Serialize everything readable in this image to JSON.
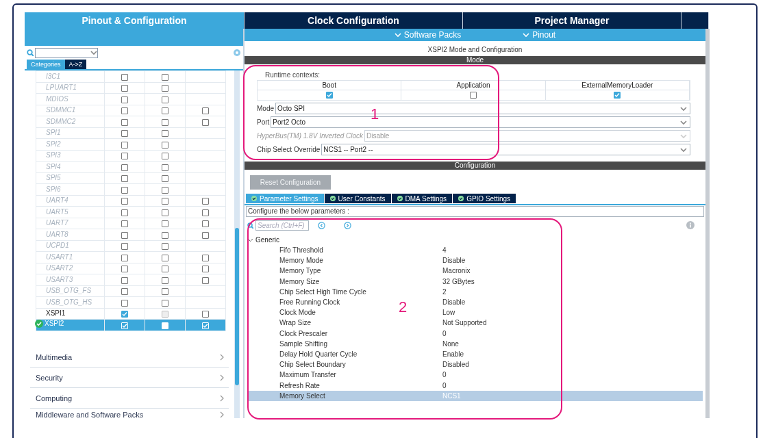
{
  "top_tabs": [
    {
      "label": "Pinout & Configuration",
      "selected": true
    },
    {
      "label": "Clock Configuration",
      "selected": false
    },
    {
      "label": "Project Manager",
      "selected": false
    },
    {
      "selected": false
    }
  ],
  "sub_menus": [
    {
      "label": "Software Packs"
    },
    {
      "label": "Pinout"
    }
  ],
  "left_panel": {
    "view_tabs": [
      {
        "label": "Categories",
        "selected": true
      },
      {
        "label": "A->Z",
        "selected": false
      }
    ],
    "peripherals": [
      {
        "name": "I3C1",
        "disabled": true,
        "selected": false,
        "configured": false,
        "checks": [
          {
            "checked": false,
            "disabled": false
          },
          {
            "checked": false,
            "disabled": false
          }
        ]
      },
      {
        "name": "LPUART1",
        "disabled": true,
        "selected": false,
        "configured": false,
        "checks": [
          {
            "checked": false,
            "disabled": false
          },
          {
            "checked": false,
            "disabled": false
          }
        ]
      },
      {
        "name": "MDIOS",
        "disabled": true,
        "selected": false,
        "configured": false,
        "checks": [
          {
            "checked": false,
            "disabled": false
          },
          {
            "checked": false,
            "disabled": false
          }
        ]
      },
      {
        "name": "SDMMC1",
        "disabled": true,
        "selected": false,
        "configured": false,
        "checks": [
          {
            "checked": false,
            "disabled": false
          },
          {
            "checked": false,
            "disabled": false
          },
          {
            "checked": false,
            "disabled": false
          }
        ]
      },
      {
        "name": "SDMMC2",
        "disabled": true,
        "selected": false,
        "configured": false,
        "checks": [
          {
            "checked": false,
            "disabled": false
          },
          {
            "checked": false,
            "disabled": false
          },
          {
            "checked": false,
            "disabled": false
          }
        ]
      },
      {
        "name": "SPI1",
        "disabled": true,
        "selected": false,
        "configured": false,
        "checks": [
          {
            "checked": false,
            "disabled": false
          },
          {
            "checked": false,
            "disabled": false
          }
        ]
      },
      {
        "name": "SPI2",
        "disabled": true,
        "selected": false,
        "configured": false,
        "checks": [
          {
            "checked": false,
            "disabled": false
          },
          {
            "checked": false,
            "disabled": false
          }
        ]
      },
      {
        "name": "SPI3",
        "disabled": true,
        "selected": false,
        "configured": false,
        "checks": [
          {
            "checked": false,
            "disabled": false
          },
          {
            "checked": false,
            "disabled": false
          }
        ]
      },
      {
        "name": "SPI4",
        "disabled": true,
        "selected": false,
        "configured": false,
        "checks": [
          {
            "checked": false,
            "disabled": false
          },
          {
            "checked": false,
            "disabled": false
          }
        ]
      },
      {
        "name": "SPI5",
        "disabled": true,
        "selected": false,
        "configured": false,
        "checks": [
          {
            "checked": false,
            "disabled": false
          },
          {
            "checked": false,
            "disabled": false
          }
        ]
      },
      {
        "name": "SPI6",
        "disabled": true,
        "selected": false,
        "configured": false,
        "checks": [
          {
            "checked": false,
            "disabled": false
          },
          {
            "checked": false,
            "disabled": false
          }
        ]
      },
      {
        "name": "UART4",
        "disabled": true,
        "selected": false,
        "configured": false,
        "checks": [
          {
            "checked": false,
            "disabled": false
          },
          {
            "checked": false,
            "disabled": false
          },
          {
            "checked": false,
            "disabled": false
          }
        ]
      },
      {
        "name": "UART5",
        "disabled": true,
        "selected": false,
        "configured": false,
        "checks": [
          {
            "checked": false,
            "disabled": false
          },
          {
            "checked": false,
            "disabled": false
          },
          {
            "checked": false,
            "disabled": false
          }
        ]
      },
      {
        "name": "UART7",
        "disabled": true,
        "selected": false,
        "configured": false,
        "checks": [
          {
            "checked": false,
            "disabled": false
          },
          {
            "checked": false,
            "disabled": false
          },
          {
            "checked": false,
            "disabled": false
          }
        ]
      },
      {
        "name": "UART8",
        "disabled": true,
        "selected": false,
        "configured": false,
        "checks": [
          {
            "checked": false,
            "disabled": false
          },
          {
            "checked": false,
            "disabled": false
          },
          {
            "checked": false,
            "disabled": false
          }
        ]
      },
      {
        "name": "UCPD1",
        "disabled": true,
        "selected": false,
        "configured": false,
        "checks": [
          {
            "checked": false,
            "disabled": false
          },
          {
            "checked": false,
            "disabled": false
          }
        ]
      },
      {
        "name": "USART1",
        "disabled": true,
        "selected": false,
        "configured": false,
        "checks": [
          {
            "checked": false,
            "disabled": false
          },
          {
            "checked": false,
            "disabled": false
          },
          {
            "checked": false,
            "disabled": false
          }
        ]
      },
      {
        "name": "USART2",
        "disabled": true,
        "selected": false,
        "configured": false,
        "checks": [
          {
            "checked": false,
            "disabled": false
          },
          {
            "checked": false,
            "disabled": false
          },
          {
            "checked": false,
            "disabled": false
          }
        ]
      },
      {
        "name": "USART3",
        "disabled": true,
        "selected": false,
        "configured": false,
        "checks": [
          {
            "checked": false,
            "disabled": false
          },
          {
            "checked": false,
            "disabled": false
          },
          {
            "checked": false,
            "disabled": false
          }
        ]
      },
      {
        "name": "USB_OTG_FS",
        "disabled": true,
        "selected": false,
        "configured": false,
        "checks": [
          {
            "checked": false,
            "disabled": false
          },
          {
            "checked": false,
            "disabled": false
          }
        ]
      },
      {
        "name": "USB_OTG_HS",
        "disabled": true,
        "selected": false,
        "configured": false,
        "checks": [
          {
            "checked": false,
            "disabled": false
          },
          {
            "checked": false,
            "disabled": false
          }
        ]
      },
      {
        "name": "XSPI1",
        "disabled": false,
        "selected": false,
        "configured": false,
        "checks": [
          {
            "checked": true,
            "disabled": false
          },
          {
            "checked": false,
            "disabled": true
          },
          {
            "checked": false,
            "disabled": false
          }
        ]
      },
      {
        "name": "XSPI2",
        "disabled": false,
        "selected": true,
        "configured": true,
        "checks": [
          {
            "checked": true,
            "disabled": false
          },
          {
            "checked": false,
            "disabled": true
          },
          {
            "checked": true,
            "disabled": false
          }
        ]
      }
    ],
    "categories": [
      {
        "label": "Multimedia"
      },
      {
        "label": "Security"
      },
      {
        "label": "Computing"
      },
      {
        "label": "Middleware and Software Packs"
      }
    ]
  },
  "main": {
    "title": "XSPI2 Mode and Configuration",
    "mode": {
      "header": "Mode",
      "runtime_label": "Runtime contexts:",
      "contexts": [
        {
          "label": "Boot",
          "checked": true
        },
        {
          "label": "Application",
          "checked": false
        },
        {
          "label": "ExternalMemoryLoader",
          "checked": true
        }
      ],
      "fields": [
        {
          "label": "Mode",
          "value": "Octo SPI",
          "disabled": false
        },
        {
          "label": "Port",
          "value": "Port2 Octo",
          "disabled": false
        },
        {
          "label": "HyperBus(TM) 1.8V Inverted Clock",
          "value": "Disable",
          "disabled": true
        },
        {
          "label": "Chip Select Override",
          "value": "NCS1 -- Port2 --",
          "disabled": false
        }
      ]
    },
    "configuration": {
      "header": "Configuration",
      "reset_button": "Reset Configuration",
      "tabs": [
        {
          "label": "Parameter Settings",
          "selected": true
        },
        {
          "label": "User Constants",
          "selected": false
        },
        {
          "label": "DMA Settings",
          "selected": false
        },
        {
          "label": "GPIO Settings",
          "selected": false
        }
      ],
      "hint": "Configure the below parameters :",
      "search": {
        "placeholder": "Search (Ctrl+F)"
      },
      "group": {
        "label": "Generic",
        "expanded": true,
        "params": [
          {
            "name": "Fifo Threshold",
            "value": "4",
            "selected": false
          },
          {
            "name": "Memory Mode",
            "value": "Disable",
            "selected": false
          },
          {
            "name": "Memory Type",
            "value": "Macronix",
            "selected": false
          },
          {
            "name": "Memory Size",
            "value": "32 GBytes",
            "selected": false
          },
          {
            "name": "Chip Select High Time Cycle",
            "value": "2",
            "selected": false
          },
          {
            "name": "Free Running Clock",
            "value": "Disable",
            "selected": false
          },
          {
            "name": "Clock Mode",
            "value": "Low",
            "selected": false
          },
          {
            "name": "Wrap Size",
            "value": "Not Supported",
            "selected": false
          },
          {
            "name": "Clock Prescaler",
            "value": "0",
            "selected": false
          },
          {
            "name": "Sample Shifting",
            "value": "None",
            "selected": false
          },
          {
            "name": "Delay Hold Quarter Cycle",
            "value": "Enable",
            "selected": false
          },
          {
            "name": "Chip Select Boundary",
            "value": "Disabled",
            "selected": false
          },
          {
            "name": "Maximum Transfer",
            "value": "0",
            "selected": false
          },
          {
            "name": "Refresh Rate",
            "value": "0",
            "selected": false
          },
          {
            "name": "Memory Select",
            "value": "NCS1",
            "selected": true
          }
        ]
      }
    }
  },
  "annotations": [
    {
      "label": "1"
    },
    {
      "label": "2"
    }
  ]
}
